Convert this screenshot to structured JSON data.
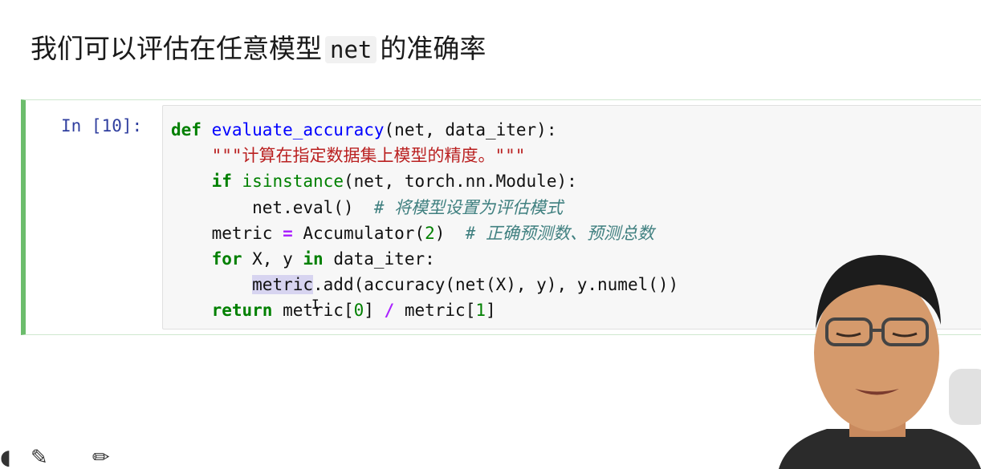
{
  "heading": {
    "prefix": "我们可以评估在任意模型",
    "code": "net",
    "suffix": "的准确率"
  },
  "cell": {
    "prompt": "In [10]:",
    "code_lines": [
      "def evaluate_accuracy(net, data_iter):",
      "    \"\"\"计算在指定数据集上模型的精度。\"\"\"",
      "    if isinstance(net, torch.nn.Module):",
      "        net.eval()  # 将模型设置为评估模式",
      "    metric = Accumulator(2)  # 正确预测数、预测总数",
      "    for X, y in data_iter:",
      "        metric.add(accuracy(net(X), y), y.numel())",
      "    return metric[0] / metric[1]"
    ]
  },
  "colors": {
    "cell_border": "#6cbd6c",
    "prompt": "#303f9f",
    "keyword": "#008000",
    "function": "#0000ff",
    "operator": "#aa22ff",
    "string": "#ba2121",
    "comment": "#408080"
  },
  "icons": [
    "edit-icon",
    "pencil-icon"
  ]
}
